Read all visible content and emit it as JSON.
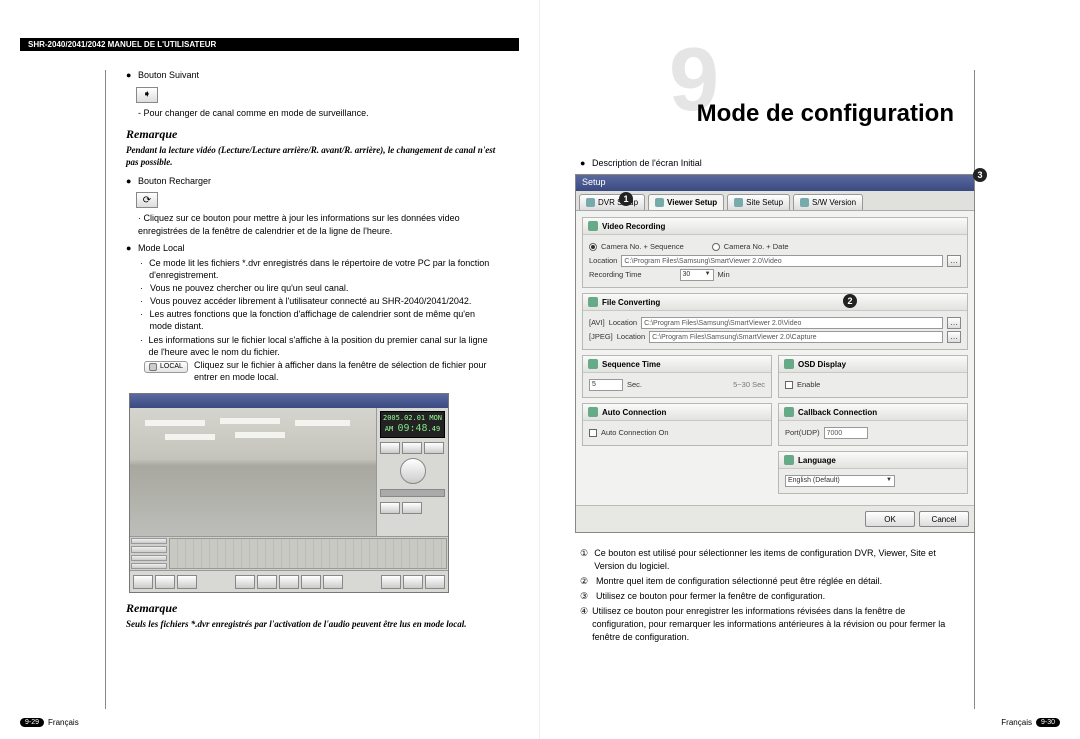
{
  "header": {
    "title": "SHR-2040/2041/2042 MANUEL DE L'UTILISATEUR"
  },
  "chapter": {
    "number": "9",
    "title": "Mode de configuration"
  },
  "left": {
    "items": [
      {
        "label": "Bouton Suivant",
        "desc": "- Pour changer de canal comme en mode de surveillance."
      },
      {
        "label": "Bouton Recharger",
        "desc": "· Cliquez sur ce bouton pour mettre à jour les informations sur les données video enregistrées de la fenêtre de calendrier et de la ligne de l'heure."
      },
      {
        "label": "Mode Local"
      }
    ],
    "remarque1": {
      "title": "Remarque",
      "body": "Pendant la lecture vidéo (Lecture/Lecture arrière/R. avant/R. arrière), le changement de canal n'est pas possible."
    },
    "local_sub": [
      "Ce mode lit les fichiers *.dvr enregistrés dans le répertoire de votre PC par la fonction d'enregistrement.",
      "Vous ne pouvez chercher ou lire qu'un seul canal.",
      "Vous pouvez accéder librement à l'utilisateur connecté au SHR-2040/2041/2042.",
      "Les autres fonctions que la fonction d'affichage de calendrier sont de même qu'en mode distant.",
      "Les informations sur le fichier local s'affiche à la position du premier canal sur la ligne de l'heure avec le nom du fichier."
    ],
    "local_chip": {
      "label": "LOCAL",
      "hint": "Cliquez sur le fichier à afficher dans la fenêtre de sélection de fichier pour entrer en mode local."
    },
    "player_time": {
      "date": "2005.02.01 MON",
      "ampm": "AM",
      "time": "09:48",
      "sec": ".49"
    },
    "remarque2": {
      "title": "Remarque",
      "body": "Seuls les fichiers *.dvr enregistrés par l'activation de l'audio peuvent être lus en mode local."
    }
  },
  "right": {
    "desc_label": "Description de l'écran Initial",
    "markers": {
      "m1": "1",
      "m2": "2",
      "m3": "3"
    },
    "setup": {
      "win_title": "Setup",
      "tabs": [
        "DVR Setup",
        "Viewer Setup",
        "Site Setup",
        "S/W Version"
      ],
      "panels": {
        "video_recording": {
          "title": "Video Recording",
          "opt1": "Camera No. + Sequence",
          "opt2": "Camera No. + Date",
          "loc_lbl": "Location",
          "loc_val": "C:\\Program Files\\Samsung\\SmartViewer 2.0\\Video",
          "rt_lbl": "Recording Time",
          "rt_val": "30",
          "rt_unit": "Min"
        },
        "file_converting": {
          "title": "File Converting",
          "avi_lbl": "[AVI]",
          "avi_loc_lbl": "Location",
          "avi_loc_val": "C:\\Program Files\\Samsung\\SmartViewer 2.0\\Video",
          "jpg_lbl": "[JPEG]",
          "jpg_loc_lbl": "Location",
          "jpg_loc_val": "C:\\Program Files\\Samsung\\SmartViewer 2.0\\Capture"
        },
        "sequence_time": {
          "title": "Sequence Time",
          "val": "5",
          "unit_lbl": "Sec.",
          "range": "5~30 Sec"
        },
        "osd": {
          "title": "OSD Display",
          "opt": "Enable"
        },
        "auto": {
          "title": "Auto Connection",
          "opt": "Auto Connection On"
        },
        "callback": {
          "title": "Callback Connection",
          "lbl": "Port(UDP)",
          "val": "7000"
        },
        "language": {
          "title": "Language",
          "val": "English (Default)"
        }
      },
      "buttons": {
        "ok": "OK",
        "cancel": "Cancel"
      }
    },
    "legend": {
      "i1": "Ce bouton est utilisé pour sélectionner les items de configuration DVR, Viewer, Site et Version du logiciel.",
      "i2": "Montre quel item de configuration sélectionné peut être réglée en détail.",
      "i3": "Utilisez ce bouton pour fermer la fenêtre de configuration.",
      "i4": "Utilisez ce bouton pour enregistrer les informations révisées dans la fenêtre de configuration, pour remarquer les informations antérieures à la révision ou pour fermer la fenêtre de configuration."
    }
  },
  "footer": {
    "lang": "Français",
    "left_pg": "9-29",
    "right_pg": "9-30"
  }
}
